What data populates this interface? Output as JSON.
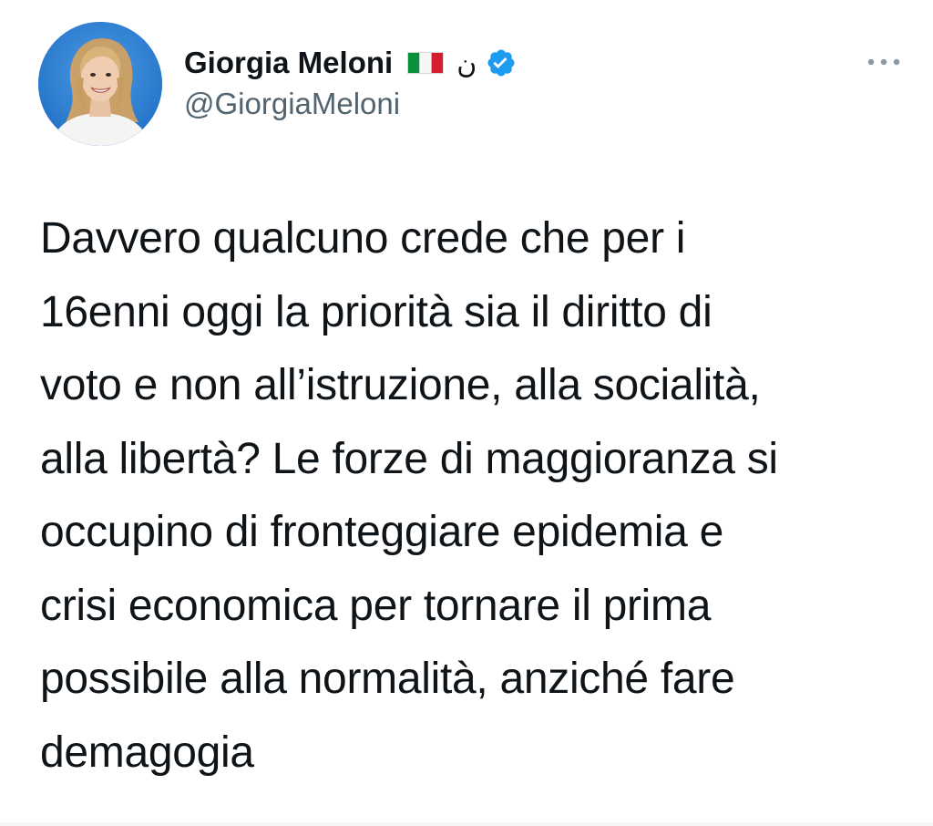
{
  "author": {
    "display_name": "Giorgia Meloni",
    "handle": "@GiorgiaMeloni",
    "flag_icon": "italy-flag-icon",
    "badge_glyph": "ن",
    "verified_icon": "verified-badge-icon",
    "verified_color": "#1d9bf0"
  },
  "tweet": {
    "text_lines": [
      "Davvero qualcuno crede che per i",
      "16enni oggi la priorità sia il diritto di",
      "voto e non all’istruzione, alla socialità,",
      "alla libertà? Le forze di maggioranza si",
      "occupino di fronteggiare epidemia e",
      "crisi economica per tornare il prima",
      "possibile alla normalità, anziché fare",
      "demagogia"
    ]
  },
  "actions": {
    "more_icon": "more-horizontal-icon"
  },
  "colors": {
    "text": "#0f1419",
    "secondary_text": "#536471",
    "background": "#ffffff"
  }
}
